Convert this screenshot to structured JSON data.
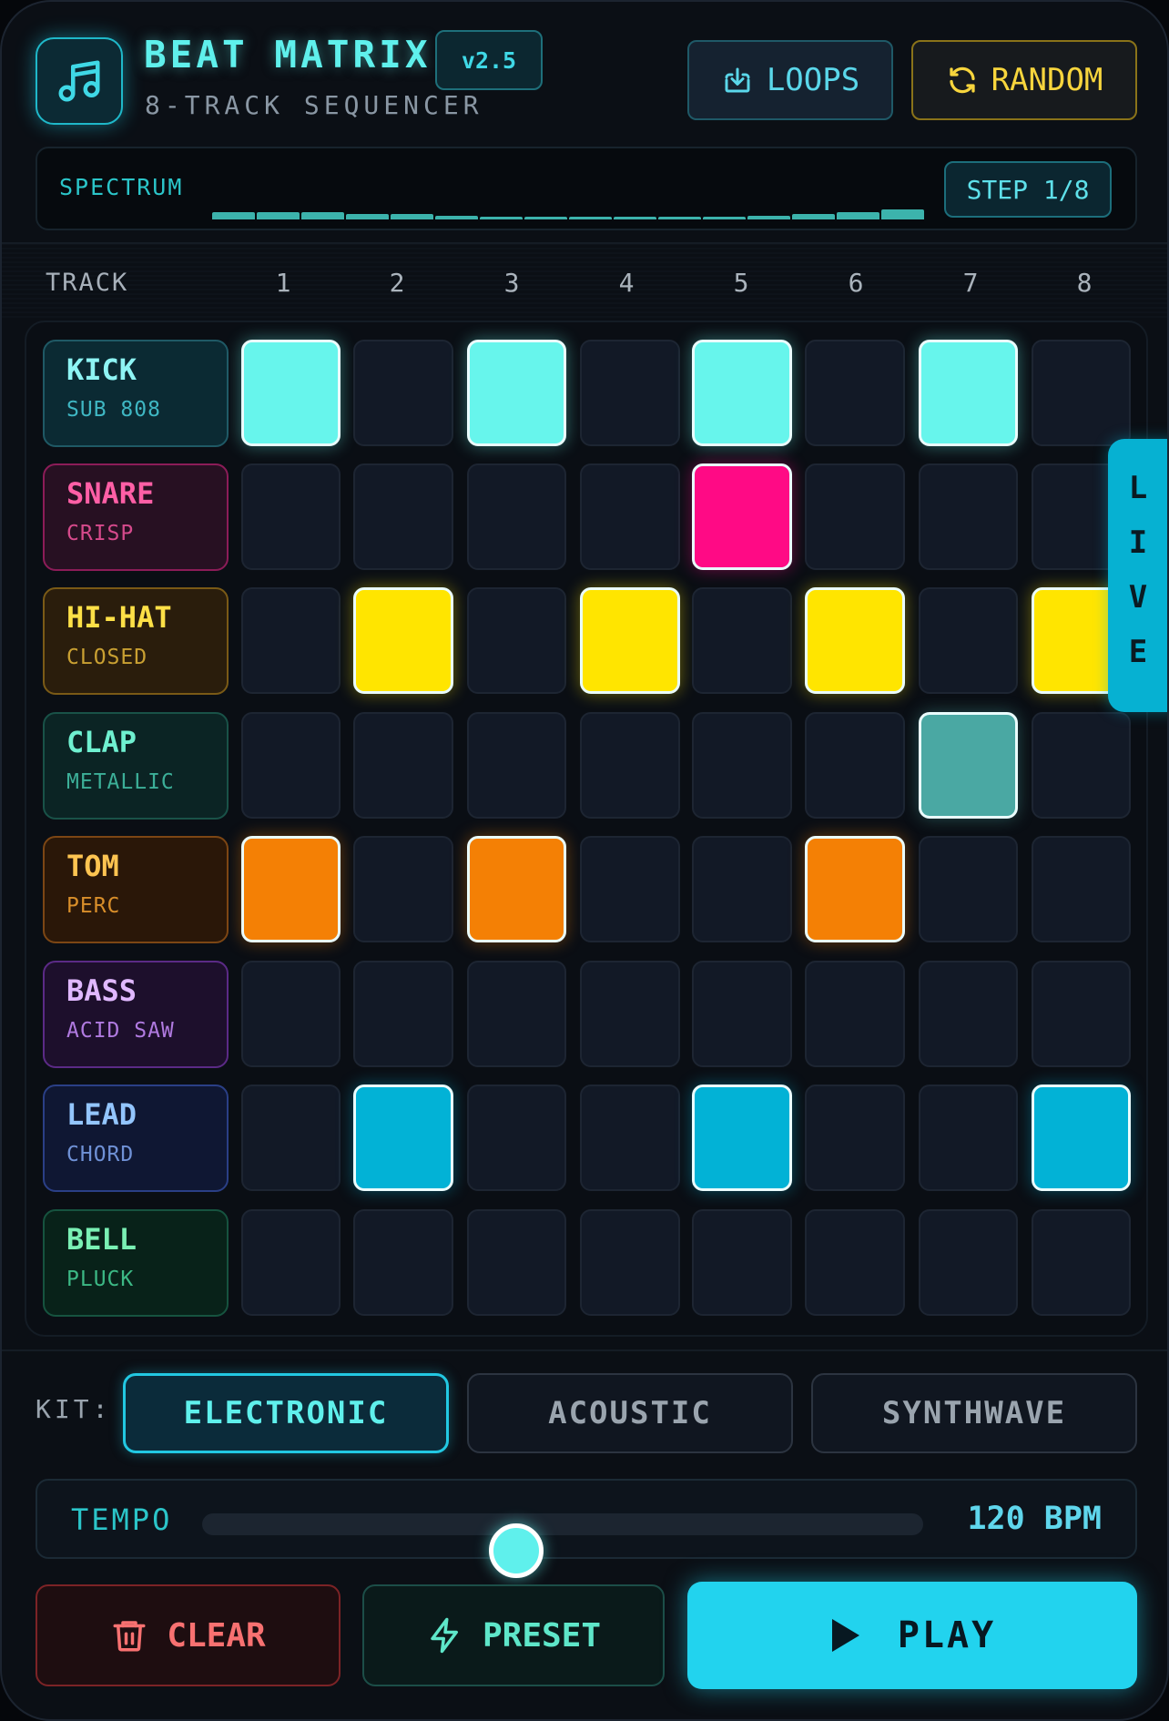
{
  "app": {
    "title": "BEAT MATRIX",
    "version": "v2.5",
    "subtitle": "8-TRACK SEQUENCER",
    "accent_color": "#22d3ee"
  },
  "toolbar": {
    "loops_label": "LOOPS",
    "loops_icon": "download-tray-icon",
    "random_label": "RANDOM",
    "random_icon": "refresh-icon"
  },
  "spectrum": {
    "label": "SPECTRUM",
    "step_badge": "STEP 1/8",
    "levels": [
      0.55,
      0.6,
      0.6,
      0.45,
      0.4,
      0.3,
      0.2,
      0.15,
      0.12,
      0.12,
      0.15,
      0.2,
      0.3,
      0.4,
      0.6,
      0.75
    ]
  },
  "grid": {
    "track_header": "TRACK",
    "steps": [
      "1",
      "2",
      "3",
      "4",
      "5",
      "6",
      "7",
      "8"
    ],
    "tracks": [
      {
        "name": "KICK",
        "sound": "SUB 808",
        "color": "#67f5ec",
        "text_color": "#8ef4f4",
        "sub_color": "#3fb7c3",
        "bg": "#0b2a33",
        "border": "#1f5965",
        "pattern": [
          1,
          0,
          1,
          0,
          1,
          0,
          1,
          0
        ]
      },
      {
        "name": "SNARE",
        "sound": "CRISP",
        "color": "#ff0a85",
        "text_color": "#ff5fa6",
        "sub_color": "#d64a8c",
        "bg": "#271022",
        "border": "#8c1c58",
        "pattern": [
          0,
          0,
          0,
          0,
          1,
          0,
          0,
          0
        ]
      },
      {
        "name": "HI-HAT",
        "sound": "CLOSED",
        "color": "#ffe500",
        "text_color": "#fde047",
        "sub_color": "#c9a032",
        "bg": "#2a1d0c",
        "border": "#7a5a16",
        "pattern": [
          0,
          1,
          0,
          1,
          0,
          1,
          0,
          1
        ]
      },
      {
        "name": "CLAP",
        "sound": "METALLIC",
        "color": "#4aa8a3",
        "text_color": "#6ff0d0",
        "sub_color": "#3caf98",
        "bg": "#0b2424",
        "border": "#195248",
        "pattern": [
          0,
          0,
          0,
          0,
          0,
          0,
          1,
          0
        ]
      },
      {
        "name": "TOM",
        "sound": "PERC",
        "color": "#f48005",
        "text_color": "#fdc451",
        "sub_color": "#d88e2a",
        "bg": "#2a1708",
        "border": "#7c4614",
        "pattern": [
          1,
          0,
          1,
          0,
          0,
          1,
          0,
          0
        ]
      },
      {
        "name": "BASS",
        "sound": "ACID SAW",
        "color": "#a855f7",
        "text_color": "#e0b8ff",
        "sub_color": "#b07ae0",
        "bg": "#1d0f2c",
        "border": "#5b2a86",
        "pattern": [
          0,
          0,
          0,
          0,
          0,
          0,
          0,
          0
        ]
      },
      {
        "name": "LEAD",
        "sound": "CHORD",
        "color": "#02b2d6",
        "text_color": "#93c5fd",
        "sub_color": "#6f91d6",
        "bg": "#0f1733",
        "border": "#2a3f86",
        "pattern": [
          0,
          1,
          0,
          0,
          1,
          0,
          0,
          1
        ]
      },
      {
        "name": "BELL",
        "sound": "PLUCK",
        "color": "#34d399",
        "text_color": "#7af0b4",
        "sub_color": "#3cb985",
        "bg": "#082219",
        "border": "#16533f",
        "pattern": [
          0,
          0,
          0,
          0,
          0,
          0,
          0,
          0
        ]
      }
    ]
  },
  "live_tab": {
    "letters": [
      "L",
      "I",
      "V",
      "E"
    ]
  },
  "kit": {
    "label": "KIT:",
    "options": [
      "ELECTRONIC",
      "ACOUSTIC",
      "SYNTHWAVE"
    ],
    "selected": "ELECTRONIC"
  },
  "tempo": {
    "label": "TEMPO",
    "value_text": "120 BPM",
    "slider_fraction": 0.435
  },
  "actions": {
    "clear_label": "CLEAR",
    "clear_icon": "trash-icon",
    "preset_label": "PRESET",
    "preset_icon": "lightning-icon",
    "play_label": "PLAY",
    "play_icon": "play-icon"
  }
}
